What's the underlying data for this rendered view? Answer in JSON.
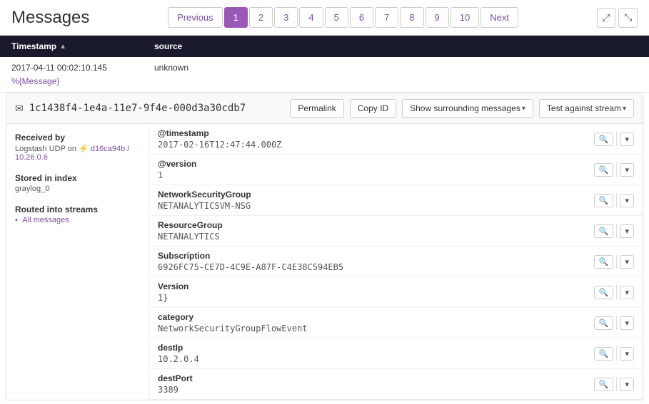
{
  "header": {
    "title": "Messages",
    "pagination": {
      "prev_label": "Previous",
      "next_label": "Next",
      "pages": [
        "1",
        "2",
        "3",
        "4",
        "5",
        "6",
        "7",
        "8",
        "9",
        "10"
      ],
      "active_page": "1"
    }
  },
  "table": {
    "col_timestamp": "Timestamp",
    "col_source": "source"
  },
  "message": {
    "timestamp": "2017-04-11 00:02:10.145",
    "source": "unknown",
    "link_text": "%{Message}",
    "id": "1c1438f4-1e4a-11e7-9f4e-000d3a30cdb7",
    "actions": {
      "permalink": "Permalink",
      "copy_id": "Copy ID",
      "surrounding": "Show surrounding messages",
      "test_stream": "Test against stream"
    },
    "sidebar": {
      "received_by_label": "Received by",
      "received_by_value": "Logstash UDP on",
      "received_by_link": "d16ca94b / 10.26.0.6",
      "stored_label": "Stored in index",
      "stored_value": "graylog_0",
      "streams_label": "Routed into streams",
      "streams_link": "All messages"
    },
    "fields": [
      {
        "name": "@timestamp",
        "value": "2017-02-16T12:47:44.000Z"
      },
      {
        "name": "@version",
        "value": "1"
      },
      {
        "name": "NetworkSecurityGroup",
        "value": "NETANALYTICSVM-NSG"
      },
      {
        "name": "ResourceGroup",
        "value": "NETANALYTICS"
      },
      {
        "name": "Subscription",
        "value": "6926FC75-CE7D-4C9E-A87F-C4E38C594EB5"
      },
      {
        "name": "Version",
        "value": "1}"
      },
      {
        "name": "category",
        "value": "NetworkSecurityGroupFlowEvent"
      },
      {
        "name": "destIp",
        "value": "10.2.0.4"
      },
      {
        "name": "destPort",
        "value": "3389"
      }
    ]
  }
}
